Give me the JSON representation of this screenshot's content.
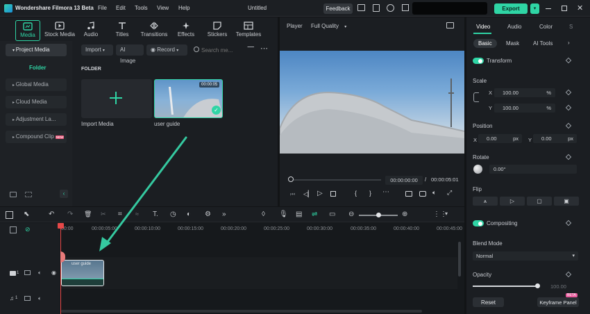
{
  "app": {
    "title": "Wondershare Filmora 13 Beta",
    "menus": [
      "File",
      "Edit",
      "Tools",
      "View",
      "Help"
    ],
    "document": "Untitled",
    "feedback": "Feedback",
    "export": "Export"
  },
  "media_tabs": [
    "Media",
    "Stock Media",
    "Audio",
    "Titles",
    "Transitions",
    "Effects",
    "Stickers",
    "Templates"
  ],
  "sidebar": {
    "items": [
      "Project Media",
      "Folder",
      "Global Media",
      "Cloud Media",
      "Adjustment La...",
      "Compound Clip"
    ],
    "badge": "NEW"
  },
  "toolbar": {
    "import": "Import",
    "ai_image": "AI Image",
    "record": "Record",
    "search_placeholder": "Search me..."
  },
  "folder": {
    "label": "FOLDER",
    "import_media": "Import Media",
    "clip_name": "user guide",
    "clip_duration": "00:00:05"
  },
  "player": {
    "label": "Player",
    "quality": "Full Quality",
    "current": "00:00:00:00",
    "separator": "/",
    "total": "00:00:05:01"
  },
  "props": {
    "tabs": [
      "Video",
      "Audio",
      "Color",
      "S"
    ],
    "subtabs": [
      "Basic",
      "Mask",
      "AI Tools"
    ],
    "transform": "Transform",
    "scale": "Scale",
    "x": "X",
    "y": "Y",
    "scale_x": "100.00",
    "scale_y": "100.00",
    "pct": "%",
    "position": "Position",
    "pos_x": "0.00",
    "pos_y": "0.00",
    "px": "px",
    "rotate": "Rotate",
    "rotate_val": "0.00°",
    "flip": "Flip",
    "compositing": "Compositing",
    "blend_mode": "Blend Mode",
    "blend_value": "Normal",
    "opacity": "Opacity",
    "opacity_value": 100,
    "opacity_text": "100.00",
    "reset": "Reset",
    "keyframe": "Keyframe Panel",
    "beta": "BETA"
  },
  "timeline": {
    "ticks": [
      "00:00",
      "00:00:05:00",
      "00:00:10:00",
      "00:00:15:00",
      "00:00:20:00",
      "00:00:25:00",
      "00:00:30:00",
      "00:00:35:00",
      "00:00:40:00",
      "00:00:45:00"
    ],
    "clip_label": "user guide",
    "track_video": "1",
    "track_audio": "1"
  },
  "colors": {
    "accent": "#2fd5a5",
    "arrow": "#35c9a0",
    "playhead": "#e54848"
  }
}
